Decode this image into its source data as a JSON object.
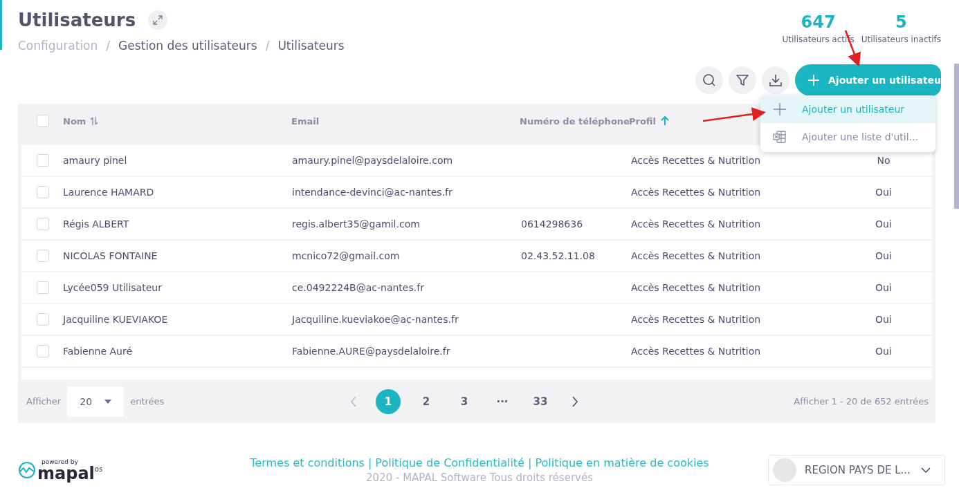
{
  "page": {
    "title": "Utilisateurs"
  },
  "breadcrumb": [
    {
      "label": "Configuration",
      "dimmed": true
    },
    {
      "separator": "/",
      "label": "Gestion des utilisateurs",
      "dimmed": false
    },
    {
      "separator": "/",
      "label": "Utilisateurs",
      "dimmed": false
    }
  ],
  "stats": [
    {
      "value": "647",
      "label": "Utilisateurs actifs"
    },
    {
      "value": "5",
      "label": "Utilisateurs inactifs"
    }
  ],
  "toolbar": {
    "add_button": "Ajouter un utilisateu"
  },
  "add_menu": [
    {
      "kind": "add",
      "label": "Ajouter un utilisateur",
      "selected": true
    },
    {
      "kind": "import",
      "label": "Ajouter une liste d'util...",
      "selected": false
    }
  ],
  "table": {
    "select_all_checked": false,
    "columns": [
      {
        "label": "Nom",
        "sortable": true,
        "sorted": false
      },
      {
        "label": "Email",
        "sortable": false,
        "sorted": false
      },
      {
        "label": "Numéro de téléphone",
        "sortable": false,
        "sorted": false
      },
      {
        "label": "Profil",
        "sortable": true,
        "sorted": true
      }
    ],
    "rows": [
      {
        "checked": false,
        "name": "amaury pinel",
        "email": "amaury.pinel@paysdelaloire.com",
        "profile": "Accès Recettes & Nutrition",
        "column_5": "No"
      },
      {
        "checked": false,
        "name": "Laurence HAMARD",
        "email": "intendance-devinci@ac-nantes.fr",
        "profile": "Accès Recettes & Nutrition",
        "column_5": "Oui"
      },
      {
        "checked": false,
        "name": "Régis ALBERT",
        "email": "regis.albert35@gamil.com",
        "phone": "0614298636",
        "profile": "Accès Recettes & Nutrition",
        "column_5": "Oui"
      },
      {
        "checked": false,
        "name": "NICOLAS FONTAINE",
        "email": "mcnico72@gmail.com",
        "phone": "02.43.52.11.08",
        "profile": "Accès Recettes & Nutrition",
        "column_5": "Oui"
      },
      {
        "checked": false,
        "name": "Lycée059 Utilisateur",
        "email": "ce.0492224B@ac-nantes.fr",
        "profile": "Accès Recettes & Nutrition",
        "column_5": "Oui"
      },
      {
        "checked": false,
        "name": "Jacquiline KUEVIAKOE",
        "email": "Jacquiline.kueviakoe@ac-nantes.fr",
        "profile": "Accès Recettes & Nutrition",
        "column_5": "Oui"
      },
      {
        "checked": false,
        "name": "Fabienne Auré",
        "email": "Fabienne.AURE@paysdelaloire.fr",
        "profile": "Accès Recettes & Nutrition",
        "column_5": "Oui"
      }
    ]
  },
  "pagination": {
    "show_label": "Afficher",
    "page_size": "20",
    "entries_label": "entrées",
    "pages": [
      {
        "label": "1",
        "selected": true
      },
      {
        "label": "2",
        "selected": false
      },
      {
        "label": "3",
        "selected": false
      },
      {
        "label": "···",
        "selected": false
      },
      {
        "label": "33",
        "selected": false
      }
    ],
    "summary": "Afficher 1 - 20 de 652 entrées"
  },
  "footer": {
    "powered_by": "powered by",
    "brand": "mapal",
    "brand_suffix": "os",
    "links": [
      {
        "label": "Termes et conditions"
      },
      {
        "separator": "|",
        "label": "Politique de Confidentialité"
      },
      {
        "separator": "|",
        "label": "Politique en matière de cookies"
      }
    ],
    "copyright": "2020 - MAPAL Software Tous droits réservés",
    "account": "REGION PAYS DE L..."
  }
}
